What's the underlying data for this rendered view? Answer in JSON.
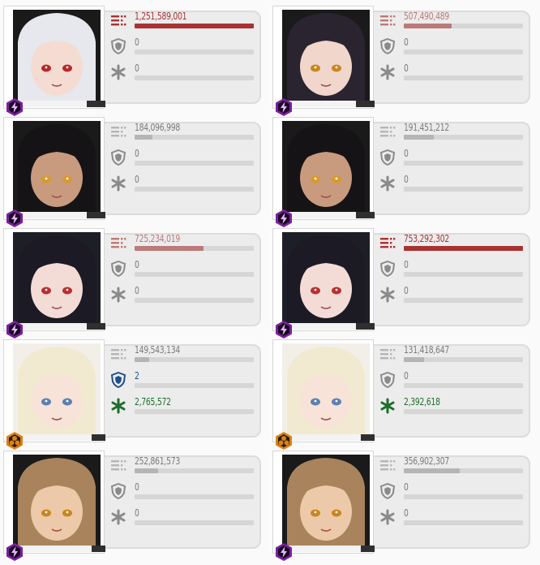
{
  "colors": {
    "damage_high": "#a83232",
    "damage_mid": "#b97a78",
    "damage_low": "#b5b5b5",
    "shield_active": "#1f4f8a",
    "heal_active": "#1c6e2a",
    "inactive_icon": "#8a8a8a",
    "burst_purple": "#7b1fa2",
    "burst_orange": "#d9821a"
  },
  "cards": [
    {
      "damage": "1,251,589,001",
      "damage_pct": 1.0,
      "damage_color": "high",
      "shield": "0",
      "shield_pct": 0,
      "heal": "0",
      "heal_pct": 0,
      "element": "electric",
      "hp_pct": 0.8,
      "hair": "#e6e8ee",
      "skin": "#f4dcd3",
      "bg": "#1a1a1a",
      "eye": "#b62a2a"
    },
    {
      "damage": "507,490,489",
      "damage_pct": 0.4,
      "damage_color": "mid",
      "shield": "0",
      "shield_pct": 0,
      "heal": "0",
      "heal_pct": 0,
      "element": "electric",
      "hp_pct": 0.8,
      "hair": "#2a2430",
      "skin": "#f1d6cc",
      "bg": "#1a1a1a",
      "eye": "#c8861f"
    },
    {
      "damage": "184,096,998",
      "damage_pct": 0.15,
      "damage_color": "low",
      "shield": "0",
      "shield_pct": 0,
      "heal": "0",
      "heal_pct": 0,
      "element": "electric",
      "hp_pct": 0.8,
      "hair": "#151315",
      "skin": "#c89a7e",
      "bg": "#1a1a1a",
      "eye": "#d99a2a"
    },
    {
      "damage": "191,451,212",
      "damage_pct": 0.25,
      "damage_color": "low",
      "shield": "0",
      "shield_pct": 0,
      "heal": "0",
      "heal_pct": 0,
      "element": "electric",
      "hp_pct": 0.8,
      "hair": "#151315",
      "skin": "#c89a7e",
      "bg": "#1a1a1a",
      "eye": "#d99a2a"
    },
    {
      "damage": "725,234,019",
      "damage_pct": 0.58,
      "damage_color": "mid",
      "shield": "0",
      "shield_pct": 0,
      "heal": "0",
      "heal_pct": 0,
      "element": "electric",
      "hp_pct": 0.8,
      "hair": "#1c1a24",
      "skin": "#f3dcd6",
      "bg": "#1d1f26",
      "eye": "#b92e2e"
    },
    {
      "damage": "753,292,302",
      "damage_pct": 1.0,
      "damage_color": "high",
      "shield": "0",
      "shield_pct": 0,
      "heal": "0",
      "heal_pct": 0,
      "element": "electric",
      "hp_pct": 0.8,
      "hair": "#1c1a24",
      "skin": "#f3dcd6",
      "bg": "#1d1f26",
      "eye": "#b92e2e"
    },
    {
      "damage": "149,543,134",
      "damage_pct": 0.12,
      "damage_color": "low",
      "shield": "2",
      "shield_pct": 0,
      "heal": "2,765,572",
      "heal_pct": 0,
      "element": "iron",
      "hp_pct": 0.85,
      "hair": "#f2ead0",
      "skin": "#f7e3d8",
      "bg": "#f1efe8",
      "eye": "#5b7fb5"
    },
    {
      "damage": "131,418,647",
      "damage_pct": 0.17,
      "damage_color": "low",
      "shield": "0",
      "shield_pct": 0,
      "heal": "2,392,618",
      "heal_pct": 0,
      "element": "iron",
      "hp_pct": 0.85,
      "hair": "#f2ead0",
      "skin": "#f7e3d8",
      "bg": "#f1efe8",
      "eye": "#5b7fb5"
    },
    {
      "damage": "252,861,573",
      "damage_pct": 0.2,
      "damage_color": "low",
      "shield": "0",
      "shield_pct": 0,
      "heal": "0",
      "heal_pct": 0,
      "element": "electric",
      "hp_pct": 0.85,
      "hair": "#a8835c",
      "skin": "#ecc9a8",
      "bg": "#1a1a1a",
      "eye": "#c8861f"
    },
    {
      "damage": "356,902,307",
      "damage_pct": 0.47,
      "damage_color": "low",
      "shield": "0",
      "shield_pct": 0,
      "heal": "0",
      "heal_pct": 0,
      "element": "electric",
      "hp_pct": 0.85,
      "hair": "#a8835c",
      "skin": "#ecc9a8",
      "bg": "#1a1a1a",
      "eye": "#c8861f"
    }
  ]
}
